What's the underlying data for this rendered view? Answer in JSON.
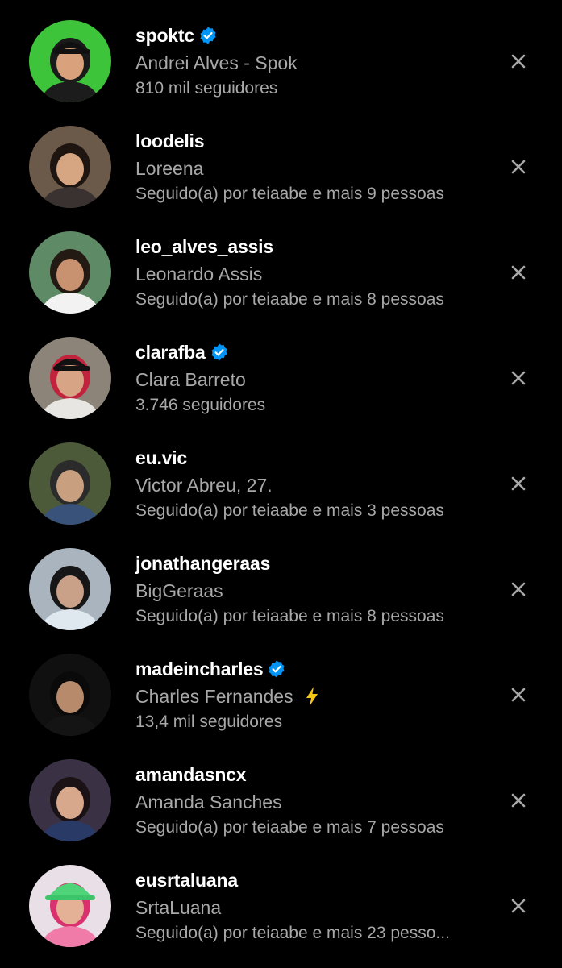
{
  "suggestions": [
    {
      "username": "spoktc",
      "verified": true,
      "name": "Andrei Alves - Spok",
      "emoji": "",
      "subtitle": "810 mil seguidores",
      "avatar_bg": "#3ec43a",
      "avatar_hair": "#1a1a1a",
      "avatar_skin": "#d9a27c",
      "avatar_shirt": "#1c1c1c",
      "avatar_icon": "person-with-cap"
    },
    {
      "username": "loodelis",
      "verified": false,
      "name": "Loreena",
      "emoji": "",
      "subtitle": "Seguido(a) por teiaabe e mais 9 pessoas",
      "avatar_bg": "#6b5a4a",
      "avatar_hair": "#1e1510",
      "avatar_skin": "#d6a682",
      "avatar_shirt": "#3a3230",
      "avatar_icon": "person"
    },
    {
      "username": "leo_alves_assis",
      "verified": false,
      "name": "Leonardo Assis",
      "emoji": "",
      "subtitle": "Seguido(a) por teiaabe e mais 8 pessoas",
      "avatar_bg": "#5e8a66",
      "avatar_hair": "#241a14",
      "avatar_skin": "#c89270",
      "avatar_shirt": "#f2f2f2",
      "avatar_icon": "person"
    },
    {
      "username": "clarafba",
      "verified": true,
      "name": "Clara Barreto",
      "emoji": "",
      "subtitle": "3.746 seguidores",
      "avatar_bg": "#8c8478",
      "avatar_hair": "#c2233c",
      "avatar_skin": "#d8a486",
      "avatar_shirt": "#e8e6e2",
      "avatar_icon": "person-with-cap"
    },
    {
      "username": "eu.vic",
      "verified": false,
      "name": "Victor Abreu, 27.",
      "emoji": "",
      "subtitle": "Seguido(a) por teiaabe e mais 3 pessoas",
      "avatar_bg": "#4d5a3a",
      "avatar_hair": "#2b2b2b",
      "avatar_skin": "#c8a080",
      "avatar_shirt": "#38527a",
      "avatar_icon": "person"
    },
    {
      "username": "jonathangeraas",
      "verified": false,
      "name": "BigGeraas",
      "emoji": "",
      "subtitle": "Seguido(a) por teiaabe e mais 8 pessoas",
      "avatar_bg": "#a9b4bf",
      "avatar_hair": "#161616",
      "avatar_skin": "#c9a088",
      "avatar_shirt": "#dfe7ef",
      "avatar_icon": "person"
    },
    {
      "username": "madeincharles",
      "verified": true,
      "name": "Charles Fernandes",
      "emoji": "⚡",
      "subtitle": "13,4 mil seguidores",
      "avatar_bg": "#101010",
      "avatar_hair": "#0a0a0a",
      "avatar_skin": "#b88a6c",
      "avatar_shirt": "#141414",
      "avatar_icon": "person"
    },
    {
      "username": "amandasncx",
      "verified": false,
      "name": "Amanda Sanches",
      "emoji": "",
      "subtitle": "Seguido(a) por teiaabe e mais 7 pessoas",
      "avatar_bg": "#3a3244",
      "avatar_hair": "#1a1214",
      "avatar_skin": "#d7a88c",
      "avatar_shirt": "#2a3a66",
      "avatar_icon": "person"
    },
    {
      "username": "eusrtaluana",
      "verified": false,
      "name": "SrtaLuana",
      "emoji": "",
      "subtitle": "Seguido(a) por teiaabe e mais 23 pesso...",
      "avatar_bg": "#e8e0e6",
      "avatar_hair": "#d9306e",
      "avatar_skin": "#e4b096",
      "avatar_shirt": "#f07aa8",
      "avatar_icon": "person-with-bucket-hat"
    }
  ],
  "colors": {
    "background": "#000000",
    "username": "#ffffff",
    "secondary_text": "#a8a8a8",
    "verified_badge": "#0095f6",
    "close_icon": "#a8a8a8",
    "lightning": "#f5c518"
  },
  "icons": {
    "verified": "verified-badge-icon",
    "dismiss": "close-icon",
    "emoji": "lightning-emoji"
  }
}
